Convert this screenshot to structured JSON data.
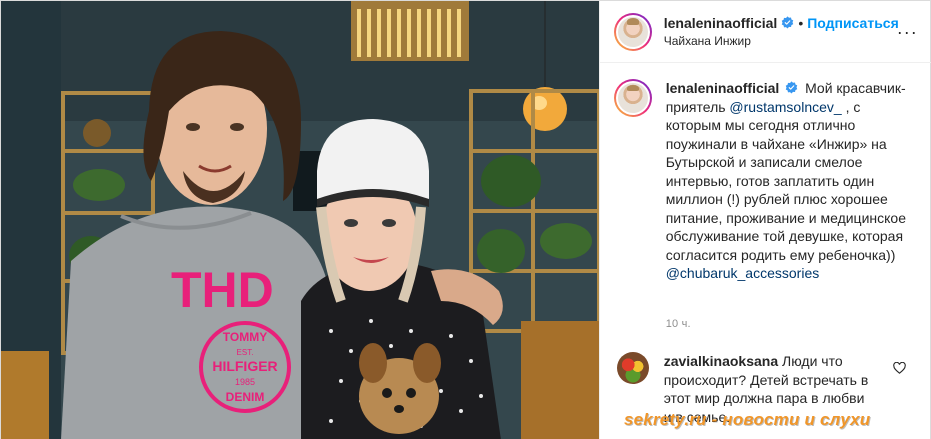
{
  "header": {
    "username": "lenaleninaofficial",
    "separator": "•",
    "follow_label": "Подписаться",
    "location": "Чайхана Инжир",
    "more_label": "···"
  },
  "caption": {
    "username": "lenaleninaofficial",
    "text_before_mention": "Мой красавчик-приятель ",
    "mention_1": "@rustamsolncev_",
    "text_after_mention": " , с которым мы сегодня отлично поужинали в чайхане «Инжир» на Бутырской и записали смелое интервью, готов заплатить один миллион (!) рублей плюс хорошее питание, проживание и медицинское обслуживание той девушке, которая согласится родить ему ребеночка))",
    "mention_2": "@chubaruk_accessories",
    "time": "10 ч."
  },
  "comment": {
    "username": "zavialkinaoksana",
    "text": "Люди что происходит? Детей встречать в этот мир должна пара в любви и в семье."
  },
  "photo": {
    "shirt_text": "THD",
    "badge_top": "TOMMY",
    "badge_est": "EST.",
    "badge_mid": "HILFIGER",
    "badge_year": "1985",
    "badge_bottom": "DENIM"
  },
  "watermark": "sekrety.ru - новости и слухи",
  "colors": {
    "follow": "#0095f6",
    "mention": "#00376b",
    "muted": "#8e8e8e",
    "verified": "#3897f0",
    "shirt_print": "#e8207a",
    "watermark": "#f0962a"
  },
  "icons": [
    "verified-badge-icon",
    "more-options-icon",
    "heart-icon"
  ]
}
